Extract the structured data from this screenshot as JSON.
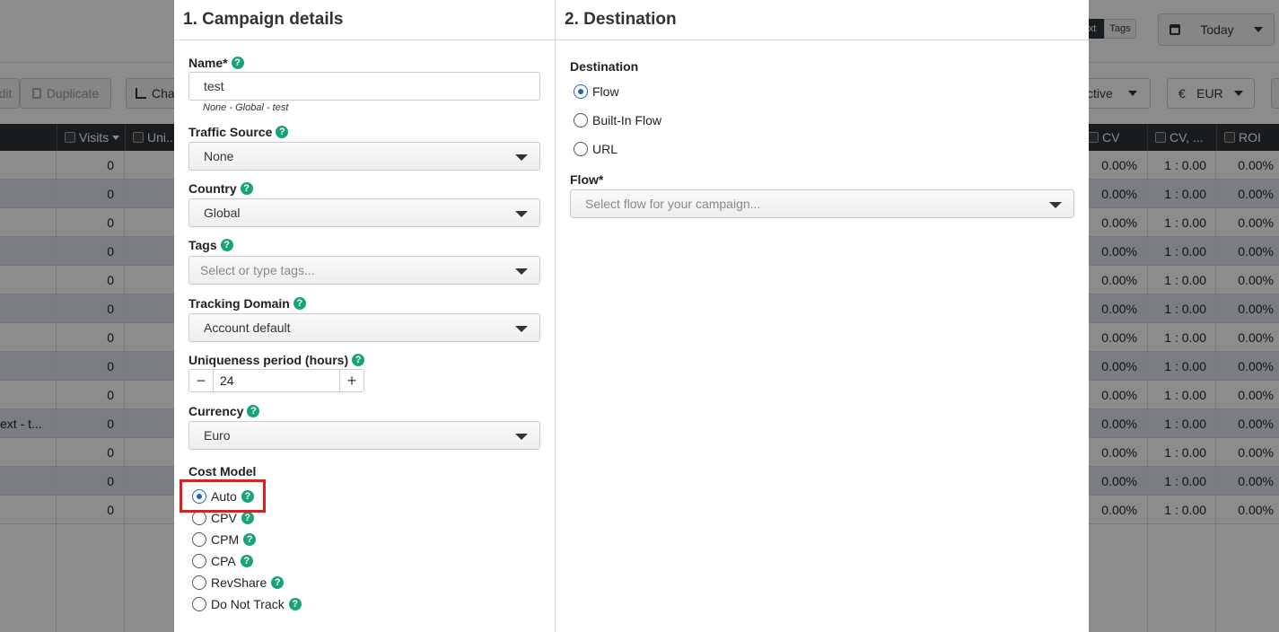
{
  "background": {
    "toolbar": {
      "edit_label": "dit",
      "duplicate_label": "Duplicate",
      "chart_label": "Cha",
      "active_label": "ctive",
      "currency_symbol": "€",
      "currency_label": "EUR",
      "text_tab": "xt",
      "tags_tab": "Tags",
      "date_label": "Today"
    },
    "columns": [
      "Visits",
      "Uni...",
      "CV",
      "CV, ...",
      "ROI"
    ],
    "rows": [
      {
        "name": "",
        "visits": "0",
        "cv": "0.00%",
        "ratio": "1 : 0.00",
        "roi": "0.00%"
      },
      {
        "name": "",
        "visits": "0",
        "cv": "0.00%",
        "ratio": "1 : 0.00",
        "roi": "0.00%"
      },
      {
        "name": "",
        "visits": "0",
        "cv": "0.00%",
        "ratio": "1 : 0.00",
        "roi": "0.00%"
      },
      {
        "name": "",
        "visits": "0",
        "cv": "0.00%",
        "ratio": "1 : 0.00",
        "roi": "0.00%"
      },
      {
        "name": "",
        "visits": "0",
        "cv": "0.00%",
        "ratio": "1 : 0.00",
        "roi": "0.00%"
      },
      {
        "name": "",
        "visits": "0",
        "cv": "0.00%",
        "ratio": "1 : 0.00",
        "roi": "0.00%"
      },
      {
        "name": "",
        "visits": "0",
        "cv": "0.00%",
        "ratio": "1 : 0.00",
        "roi": "0.00%"
      },
      {
        "name": "",
        "visits": "0",
        "cv": "0.00%",
        "ratio": "1 : 0.00",
        "roi": "0.00%"
      },
      {
        "name": "",
        "visits": "0",
        "cv": "0.00%",
        "ratio": "1 : 0.00",
        "roi": "0.00%"
      },
      {
        "name": "ext - t...",
        "visits": "0",
        "cv": "0.00%",
        "ratio": "1 : 0.00",
        "roi": "0.00%"
      },
      {
        "name": "",
        "visits": "0",
        "cv": "0.00%",
        "ratio": "1 : 0.00",
        "roi": "0.00%"
      },
      {
        "name": "",
        "visits": "0",
        "cv": "0.00%",
        "ratio": "1 : 0.00",
        "roi": "0.00%"
      },
      {
        "name": "",
        "visits": "0",
        "cv": "0.00%",
        "ratio": "1 : 0.00",
        "roi": "0.00%"
      }
    ]
  },
  "modal": {
    "left": {
      "title": "1. Campaign details",
      "name_label": "Name*",
      "name_value": "test",
      "name_hint": "None - Global - test",
      "traffic_source_label": "Traffic Source",
      "traffic_source_value": "None",
      "country_label": "Country",
      "country_value": "Global",
      "tags_label": "Tags",
      "tags_placeholder": "Select or type tags...",
      "tracking_domain_label": "Tracking Domain",
      "tracking_domain_value": "Account default",
      "uniqueness_label": "Uniqueness period (hours)",
      "uniqueness_value": "24",
      "currency_label": "Currency",
      "currency_value": "Euro",
      "cost_model_label": "Cost Model",
      "cost_models": [
        {
          "label": "Auto",
          "selected": true
        },
        {
          "label": "CPV",
          "selected": false
        },
        {
          "label": "CPM",
          "selected": false
        },
        {
          "label": "CPA",
          "selected": false
        },
        {
          "label": "RevShare",
          "selected": false
        },
        {
          "label": "Do Not Track",
          "selected": false
        }
      ]
    },
    "right": {
      "title": "2. Destination",
      "destination_label": "Destination",
      "destinations": [
        {
          "label": "Flow",
          "selected": true
        },
        {
          "label": "Built-In Flow",
          "selected": false
        },
        {
          "label": "URL",
          "selected": false
        }
      ],
      "flow_label": "Flow*",
      "flow_placeholder": "Select flow for your campaign..."
    }
  },
  "help_glyph": "?",
  "stepper": {
    "minus": "−",
    "plus": "+"
  },
  "colors": {
    "help_icon": "#1aa37a",
    "radio_selected": "#1e63c4",
    "highlight_box": "#e02020",
    "table_header": "#2e3338",
    "alt_row": "#dfe6ef"
  }
}
